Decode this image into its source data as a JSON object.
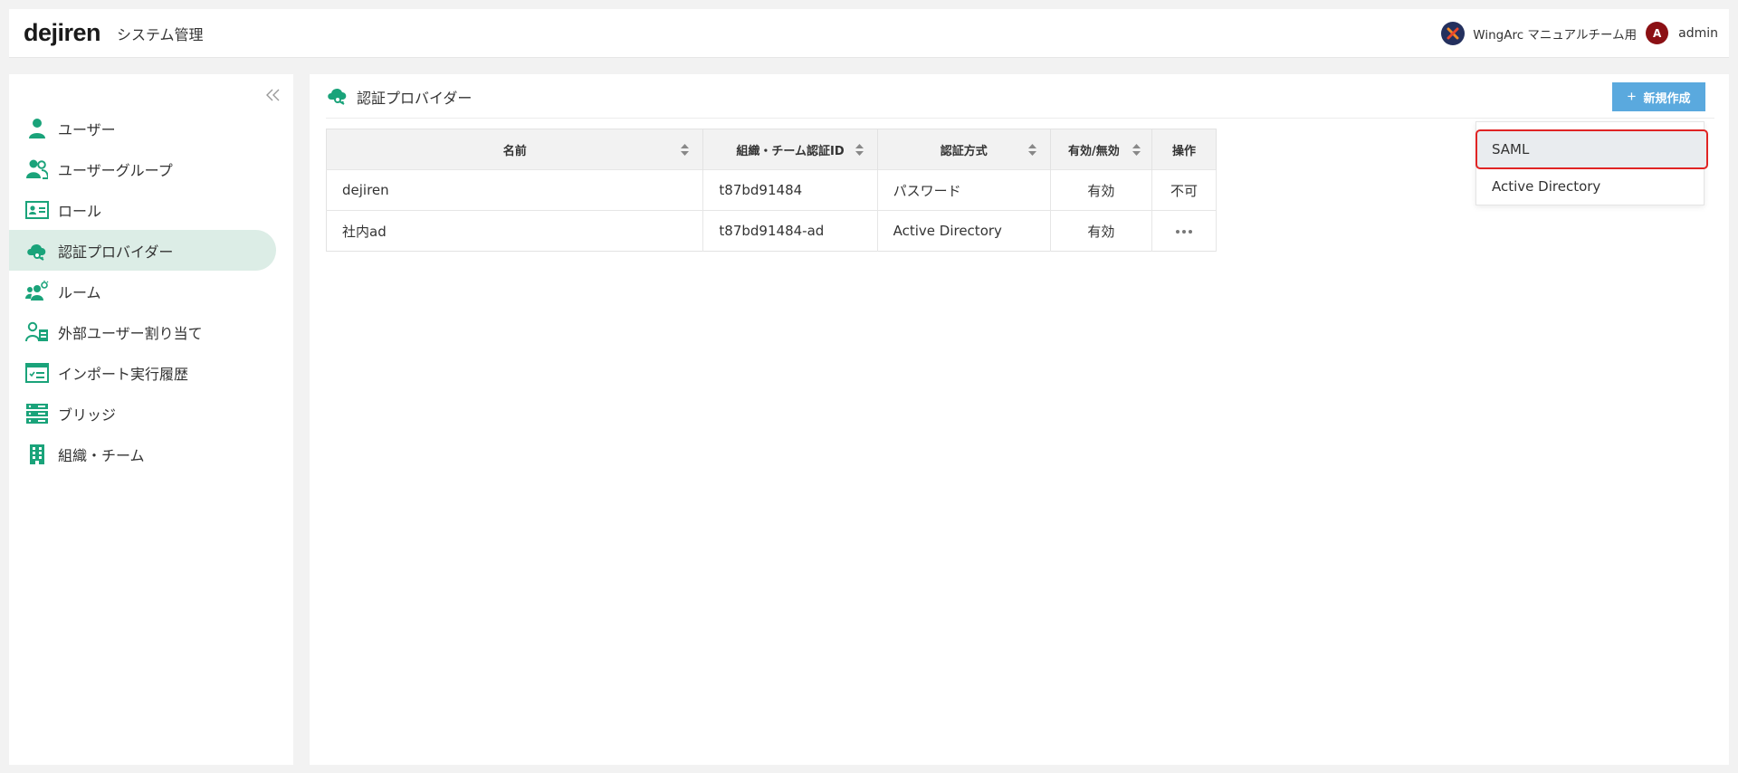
{
  "header": {
    "logo": "dejiren",
    "app_title": "システム管理",
    "org_name": "WingArc マニュアルチーム用",
    "avatar_initial": "A",
    "user_name": "admin"
  },
  "sidebar": {
    "items": [
      {
        "label": "ユーザー",
        "icon": "user-icon"
      },
      {
        "label": "ユーザーグループ",
        "icon": "user-group-icon"
      },
      {
        "label": "ロール",
        "icon": "role-card-icon"
      },
      {
        "label": "認証プロバイダー",
        "icon": "cloud-key-icon",
        "active": true
      },
      {
        "label": "ルーム",
        "icon": "room-icon"
      },
      {
        "label": "外部ユーザー割り当て",
        "icon": "external-user-icon"
      },
      {
        "label": "インポート実行履歴",
        "icon": "import-history-icon"
      },
      {
        "label": "ブリッジ",
        "icon": "bridge-server-icon"
      },
      {
        "label": "組織・チーム",
        "icon": "building-icon"
      }
    ]
  },
  "main": {
    "page_title": "認証プロバイダー",
    "new_button_label": "新規作成",
    "table": {
      "columns": [
        "名前",
        "組織・チーム認証ID",
        "認証方式",
        "有効/無効",
        "操作"
      ],
      "rows": [
        {
          "name": "dejiren",
          "auth_id": "t87bd91484",
          "method": "パスワード",
          "status": "有効",
          "action": "不可"
        },
        {
          "name": "社内ad",
          "auth_id": "t87bd91484-ad",
          "method": "Active Directory",
          "status": "有効",
          "action": "..."
        }
      ]
    },
    "dropdown": {
      "items": [
        "SAML",
        "Active Directory"
      ]
    }
  },
  "colors": {
    "accent_green": "#1aa37a",
    "button_blue": "#5aa9de",
    "active_nav_bg": "#dcede6",
    "highlight_red": "#e02424"
  }
}
